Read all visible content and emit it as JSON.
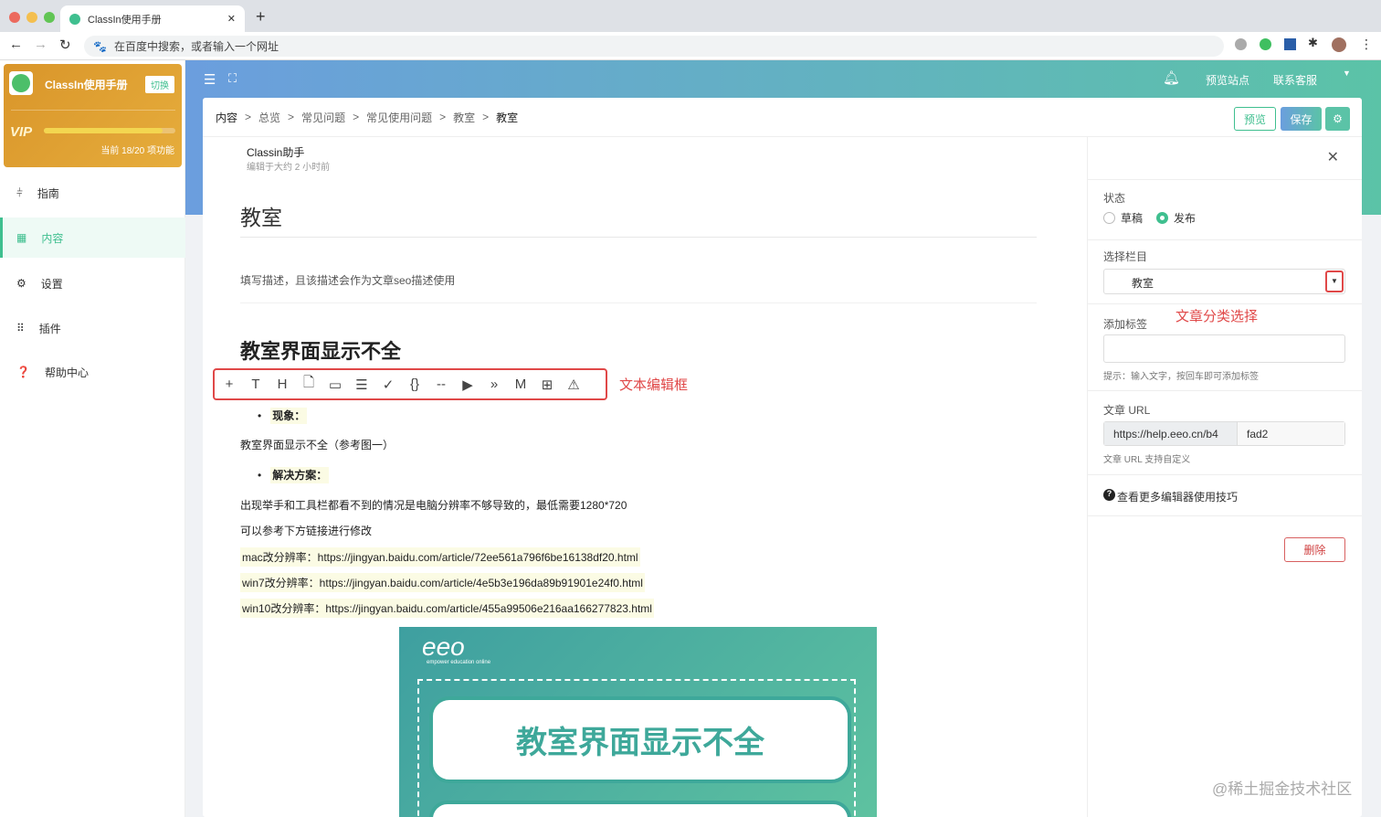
{
  "browser": {
    "tab_title": "ClassIn使用手册",
    "omnibox_placeholder": "在百度中搜索，或者输入一个网址"
  },
  "sidebar": {
    "brand": "ClassIn使用手册",
    "switch_label": "切换",
    "vip_label": "VIP",
    "vip_progress": 0.9,
    "vip_usage": "当前 18/20 项功能",
    "items": [
      {
        "label": "指南"
      },
      {
        "label": "内容"
      },
      {
        "label": "设置"
      },
      {
        "label": "插件"
      },
      {
        "label": "帮助中心"
      }
    ]
  },
  "header": {
    "preview_site": "预览站点",
    "contact": "联系客服"
  },
  "breadcrumb": [
    "内容",
    "总览",
    "常见问题",
    "常见使用问题",
    "教室",
    "教室"
  ],
  "toolbar": {
    "preview": "预览",
    "save": "保存"
  },
  "article": {
    "author": "Classin助手",
    "edited": "编辑于大约 2 小时前",
    "title": "教室",
    "description_placeholder": "填写描述，且该描述会作为文章seo描述使用",
    "heading": "教室界面显示不全",
    "editor_annotation": "文本编辑框",
    "bullet1": "现象：",
    "para1": "教室界面显示不全（参考图一）",
    "bullet2": "解决方案：",
    "para2": "出现举手和工具栏都看不到的情况是电脑分辨率不够导致的，最低需要1280*720",
    "para3": "可以参考下方链接进行修改",
    "links": [
      "mac改分辨率：https://jingyan.baidu.com/article/72ee561a796f6be16138df20.html",
      "win7改分辨率：https://jingyan.baidu.com/article/4e5b3e196da89b91901e24f0.html",
      "win10改分辨率：https://jingyan.baidu.com/article/455a99506e216aa166277823.html"
    ],
    "image_logo": "eeo",
    "image_tagline": "empower education online",
    "image_caption": "教室界面显示不全"
  },
  "panel": {
    "status_label": "状态",
    "draft": "草稿",
    "publish": "发布",
    "category_label": "选择栏目",
    "category_value": "教室",
    "category_annotation": "文章分类选择",
    "tags_label": "添加标签",
    "tags_hint": "提示：输入文字，按回车即可添加标签",
    "url_label": "文章 URL",
    "url_prefix": "https://help.eeo.cn/b4",
    "url_suffix": "fad2",
    "url_hint": "文章 URL 支持自定义",
    "tips_link": "查看更多编辑器使用技巧",
    "delete": "删除"
  },
  "watermark": "@稀土掘金技术社区",
  "colors": {
    "accent": "#3fbf8f",
    "annotation": "#e04848"
  }
}
